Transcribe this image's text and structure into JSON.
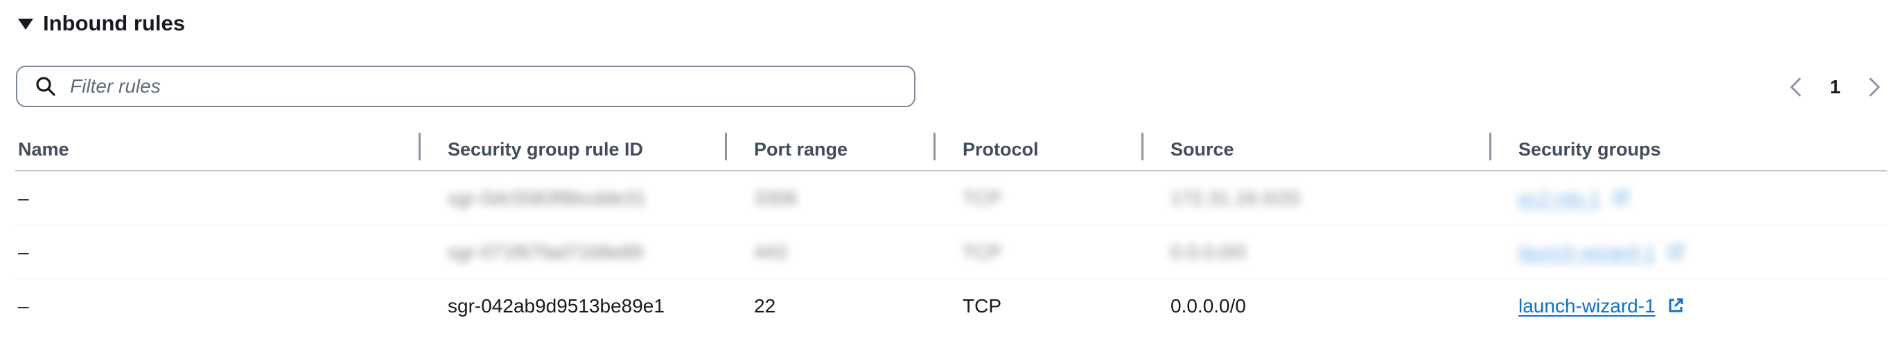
{
  "section": {
    "title": "Inbound rules"
  },
  "filter": {
    "placeholder": "Filter rules",
    "value": ""
  },
  "pagination": {
    "current_page": "1"
  },
  "table": {
    "columns": [
      "Name",
      "Security group rule ID",
      "Port range",
      "Protocol",
      "Source",
      "Security groups"
    ],
    "rows": [
      {
        "name": "–",
        "rule_id": "sgr-0dc5583f8bcdde31",
        "port_range": "3306",
        "protocol": "TCP",
        "source": "172.31.16.0/20",
        "security_group": "ec2-rds-1",
        "obscured": true
      },
      {
        "name": "–",
        "rule_id": "sgr-071f67fad7168e89",
        "port_range": "443",
        "protocol": "TCP",
        "source": "0.0.0.0/0",
        "security_group": "launch-wizard-1",
        "obscured": true
      },
      {
        "name": "–",
        "rule_id": "sgr-042ab9d9513be89e1",
        "port_range": "22",
        "protocol": "TCP",
        "source": "0.0.0.0/0",
        "security_group": "launch-wizard-1",
        "obscured": false
      }
    ]
  },
  "colors": {
    "link": "#0972d3",
    "text": "#16191f",
    "header_text": "#414d5c",
    "border": "#7d8998"
  },
  "icons": {
    "caret": "caret-down-icon",
    "search": "search-icon",
    "prev": "chevron-left-icon",
    "next": "chevron-right-icon",
    "external": "external-link-icon"
  }
}
